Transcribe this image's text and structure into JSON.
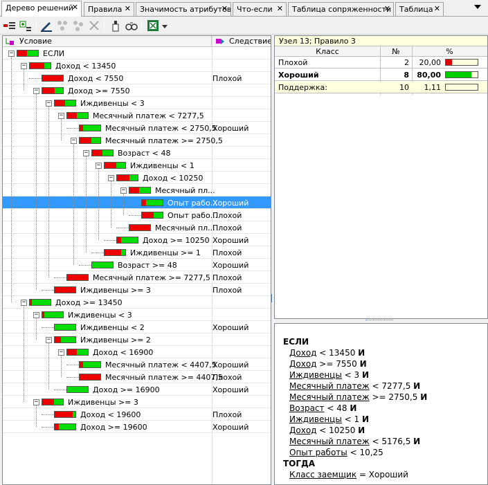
{
  "tabs": [
    {
      "label": "Дерево решений",
      "active": true
    },
    {
      "label": "Правила"
    },
    {
      "label": "Значимость атрибутов"
    },
    {
      "label": "Что-если"
    },
    {
      "label": "Таблица сопряженности"
    },
    {
      "label": "Таблица"
    }
  ],
  "toolbar": {
    "icons": [
      "expand-all-icon",
      "collapse-all-icon",
      "tree-properties-icon",
      "node-add-icon",
      "node-edit-icon",
      "delete-icon",
      "filter-icon",
      "find-icon",
      "excel-export-icon",
      "dropdown-arrow-icon"
    ]
  },
  "tree": {
    "col_condition": "Условие",
    "col_result": "Следствие",
    "rows": [
      {
        "level": 0,
        "label": "ЕСЛИ",
        "redPct": 0.45,
        "exp": "-"
      },
      {
        "level": 1,
        "label": "Доход < 13450",
        "redPct": 0.7,
        "exp": "-"
      },
      {
        "level": 2,
        "label": "Доход < 7550",
        "redPct": 1.0,
        "result": "Плохой"
      },
      {
        "level": 2,
        "label": "Доход >= 7550",
        "redPct": 0.6,
        "exp": "-"
      },
      {
        "level": 3,
        "label": "Иждивенцы < 3",
        "redPct": 0.5,
        "exp": "-"
      },
      {
        "level": 4,
        "label": "Месячный платеж < 7277,5",
        "redPct": 0.45,
        "exp": "-"
      },
      {
        "level": 5,
        "label": "Месячный платеж < 2750,5",
        "redPct": 0.15,
        "result": "Хороший"
      },
      {
        "level": 5,
        "label": "Месячный платеж >= 2750,5",
        "redPct": 0.55,
        "exp": "-"
      },
      {
        "level": 6,
        "label": "Возраст < 48",
        "redPct": 0.5,
        "exp": "-"
      },
      {
        "level": 7,
        "label": "Иждивенцы < 1",
        "redPct": 0.55,
        "exp": "-"
      },
      {
        "level": 8,
        "label": "Доход < 10250",
        "redPct": 0.6,
        "exp": "-"
      },
      {
        "level": 9,
        "label": "Месячный пл...",
        "redPct": 0.45,
        "exp": "-"
      },
      {
        "level": 10,
        "label": "Опыт рабо...",
        "redPct": 0.2,
        "result": "Хороший",
        "selected": true
      },
      {
        "level": 10,
        "label": "Опыт рабо...",
        "redPct": 0.55,
        "result": "Плохой"
      },
      {
        "level": 9,
        "label": "Месячный пл...",
        "redPct": 1.0,
        "result": "Плохой"
      },
      {
        "level": 8,
        "label": "Доход >= 10250",
        "redPct": 0.2,
        "result": "Хороший"
      },
      {
        "level": 7,
        "label": "Иждивенцы >= 1",
        "redPct": 0.8,
        "result": "Плохой"
      },
      {
        "level": 6,
        "label": "Возраст >= 48",
        "redPct": 0.0,
        "result": "Хороший"
      },
      {
        "level": 4,
        "label": "Месячный платеж >= 7277,5",
        "redPct": 1.0,
        "result": "Плохой"
      },
      {
        "level": 3,
        "label": "Иждивенцы >= 3",
        "redPct": 1.0,
        "result": "Плохой"
      },
      {
        "level": 1,
        "label": "Доход >= 13450",
        "redPct": 0.1,
        "exp": "-"
      },
      {
        "level": 2,
        "label": "Иждивенцы < 3",
        "redPct": 0.1,
        "exp": "-"
      },
      {
        "level": 3,
        "label": "Иждивенцы < 2",
        "redPct": 0.0,
        "result": "Хороший"
      },
      {
        "level": 3,
        "label": "Иждивенцы >= 2",
        "redPct": 0.3,
        "exp": "-"
      },
      {
        "level": 4,
        "label": "Доход < 16900",
        "redPct": 0.45,
        "exp": "-"
      },
      {
        "level": 5,
        "label": "Месячный платеж < 4407,5",
        "redPct": 0.15,
        "result": "Хороший"
      },
      {
        "level": 5,
        "label": "Месячный платеж >= 4407,5",
        "redPct": 1.0,
        "result": "Плохой"
      },
      {
        "level": 4,
        "label": "Доход >= 16900",
        "redPct": 0.0,
        "result": "Хороший"
      },
      {
        "level": 2,
        "label": "Иждивенцы >= 3",
        "redPct": 0.55,
        "exp": "-"
      },
      {
        "level": 3,
        "label": "Доход < 19600",
        "redPct": 0.85,
        "result": "Плохой"
      },
      {
        "level": 3,
        "label": "Доход >= 19600",
        "redPct": 0.2,
        "result": "Хороший"
      }
    ]
  },
  "node": {
    "header": "Узел 13; Правило 3",
    "col_class": "Класс",
    "col_num": "№",
    "col_pct": "%",
    "rows": [
      {
        "cls": "Плохой",
        "num": "2",
        "pct": "20,00",
        "fill": 0.2,
        "color": "#e00000",
        "bold": false
      },
      {
        "cls": "Хороший",
        "num": "8",
        "pct": "80,00",
        "fill": 0.8,
        "color": "#00d000",
        "bold": true
      },
      {
        "cls": "Поддержка:",
        "num": "10",
        "pct": "1,11",
        "fill": 0.0,
        "color": "#ffffe0",
        "bold": false,
        "support": true
      }
    ]
  },
  "rule": {
    "if_kw": "ЕСЛИ",
    "then_kw": "ТОГДА",
    "and_kw": "И",
    "conditions": [
      {
        "attr": "Доход",
        "op": "< 13450"
      },
      {
        "attr": "Доход",
        "op": ">= 7550"
      },
      {
        "attr": "Иждивенцы",
        "op": "< 3"
      },
      {
        "attr": "Месячный платеж",
        "op": "< 7277,5"
      },
      {
        "attr": "Месячный платеж",
        "op": ">= 2750,5"
      },
      {
        "attr": "Возраст",
        "op": "< 48"
      },
      {
        "attr": "Иждивенцы",
        "op": "< 1"
      },
      {
        "attr": "Доход",
        "op": "< 10250"
      },
      {
        "attr": "Месячный платеж",
        "op": "< 5176,5"
      },
      {
        "attr": "Опыт работы",
        "op": "< 10,25"
      }
    ],
    "conclusion": {
      "attr": "Класс заемщик",
      "op": "= Хороший"
    }
  }
}
